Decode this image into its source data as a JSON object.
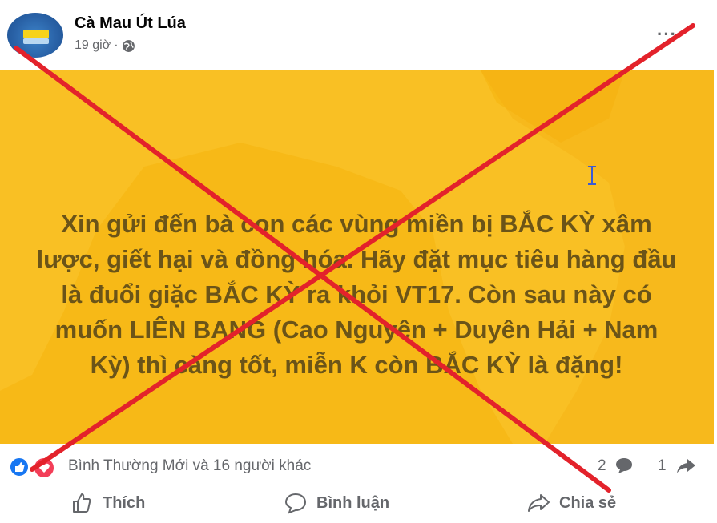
{
  "post": {
    "author": "Cà Mau Út Lúa",
    "time": "19 giờ",
    "separator": "·",
    "more_label": "···"
  },
  "banner": {
    "text": "Xin gửi đến bà con các vùng miền bị BẮC KỲ xâm lược, giết hại và đồng hóa. Hãy đặt mục tiêu hàng đầu là đuổi giặc BẮC KỲ ra khỏi VT17. Còn sau này có muốn LIÊN BANG (Cao Nguyên + Duyên Hải + Nam Kỳ) thì càng tốt, miễn K còn BẮC KỲ là đặng!",
    "background": "#f7b917",
    "text_color": "#6b5418"
  },
  "reactions": {
    "names": "Bình Thường Mới và 16 người khác",
    "comment_count": "2",
    "share_count": "1"
  },
  "actions": {
    "like": "Thích",
    "comment": "Bình luận",
    "share": "Chia sẻ"
  },
  "icons": [
    "globe-icon",
    "more-icon",
    "like-reaction-icon",
    "love-reaction-icon",
    "comment-icon",
    "share-icon",
    "like-icon",
    "text-cursor-icon"
  ],
  "colors": {
    "overlay_cross": "#e3222b",
    "facebook_blue": "#1877f2",
    "love_red": "#f33e58",
    "muted_text": "#65676b"
  }
}
